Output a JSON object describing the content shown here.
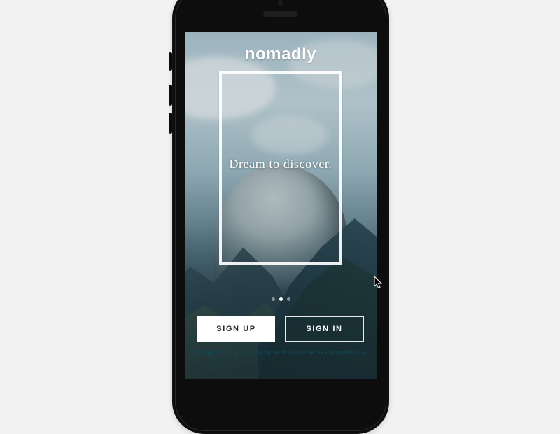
{
  "app": {
    "name": "nomadly"
  },
  "hero": {
    "tagline": "Dream to discover."
  },
  "pager": {
    "count": 3,
    "active_index": 1
  },
  "buttons": {
    "signup": "SIGN UP",
    "signin": "SIGN IN"
  },
  "disclaimer": "By sign in or sign up you agree to all our terms and conditions.",
  "colors": {
    "accent_dark": "#1f2a30",
    "link_teal": "#104c5c",
    "frame_white": "#ffffff"
  }
}
